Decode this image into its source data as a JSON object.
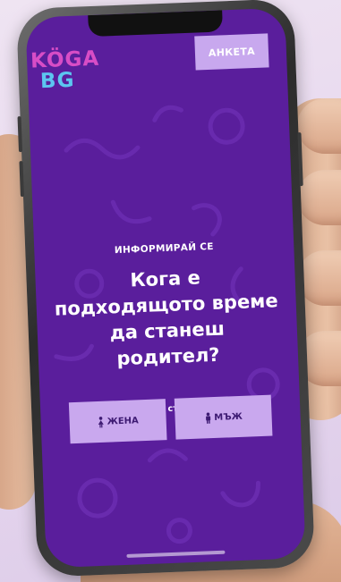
{
  "logo": {
    "line1": "KÖGA",
    "line2": "BG"
  },
  "header": {
    "survey_label": "АНКЕТА"
  },
  "main": {
    "eyebrow": "ИНФОРМИРАЙ СЕ",
    "headline": "Кога е подходящото време да станеш родител?",
    "i_am": "аз съм",
    "options": {
      "female": "ЖЕНА",
      "male": "МЪЖ"
    }
  },
  "colors": {
    "screen_bg": "#5a1e9c",
    "button_bg": "#c9a8ee",
    "logo_pink": "#d84dc6",
    "logo_blue": "#5cc6f0"
  },
  "icons": {
    "female": "female-figure-icon",
    "male": "male-figure-icon"
  }
}
